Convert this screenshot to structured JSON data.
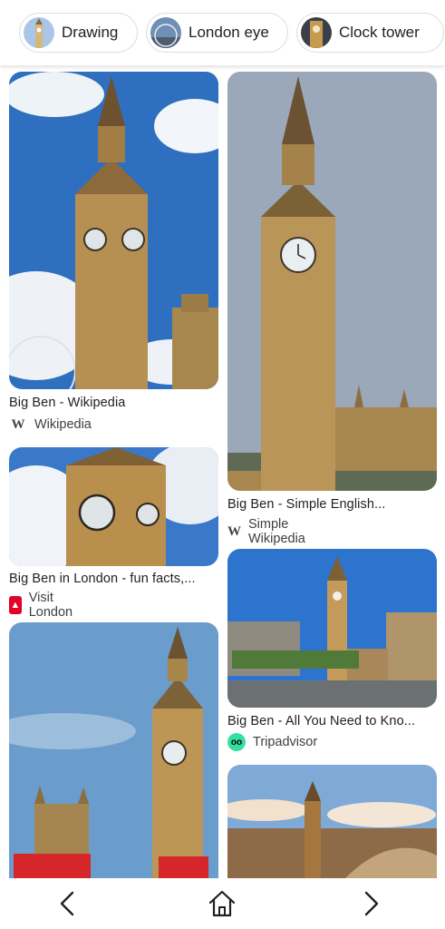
{
  "chips": [
    {
      "label": "Drawing",
      "icon": "drawing-thumbnail"
    },
    {
      "label": "London eye",
      "icon": "london-eye-thumbnail"
    },
    {
      "label": "Clock tower",
      "icon": "clock-tower-thumbnail"
    }
  ],
  "results": [
    {
      "title": "Big Ben - Wikipedia",
      "source": "Wikipedia",
      "source_icon": "wikipedia-icon"
    },
    {
      "title": "Big Ben - Simple English...",
      "source": "Simple Wikipedia",
      "source_icon": "wikipedia-icon"
    },
    {
      "title": "Big Ben in London - fun facts,...",
      "source": "Visit London",
      "source_icon": "visit-london-icon"
    },
    {
      "title": "Big Ben - All You Need to Kno...",
      "source": "Tripadvisor",
      "source_icon": "tripadvisor-icon"
    },
    {
      "title": "",
      "source": "",
      "source_icon": ""
    },
    {
      "title": "",
      "source": "",
      "source_icon": ""
    }
  ],
  "nav": {
    "back_icon": "chevron-left-icon",
    "home_icon": "home-icon",
    "forward_icon": "chevron-right-icon"
  },
  "colors": {
    "sky": "#2f6fc0",
    "stone": "#b58f55",
    "text": "#202124",
    "border": "#dadce0"
  }
}
